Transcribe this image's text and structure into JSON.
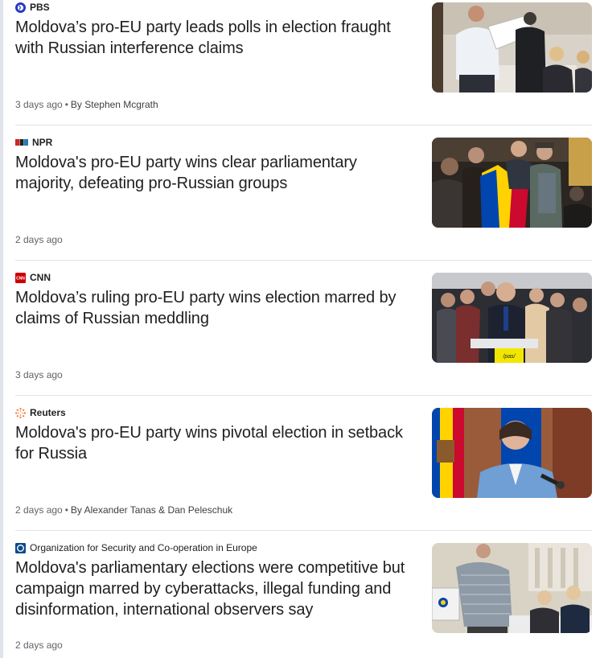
{
  "articles": [
    {
      "source": "PBS",
      "logo": "pbs-logo",
      "headline": "Moldova’s pro-EU party leads polls in election fraught with Russian interference claims",
      "time": "3 days ago",
      "byline": "By Stephen Mcgrath",
      "image": "vote-counting-photo"
    },
    {
      "source": "NPR",
      "logo": "npr-logo",
      "headline": "Moldova's pro-EU party wins clear parliamentary majority, defeating pro-Russian groups",
      "time": "2 days ago",
      "byline": "",
      "image": "supporters-with-flag-photo"
    },
    {
      "source": "CNN",
      "logo": "cnn-logo",
      "headline": "Moldova’s ruling pro-EU party wins election marred by claims of Russian meddling",
      "time": "3 days ago",
      "byline": "",
      "image": "speaker-at-podium-photo"
    },
    {
      "source": "Reuters",
      "logo": "reuters-logo",
      "headline": "Moldova's pro-EU party wins pivotal election in setback for Russia",
      "time": "2 days ago",
      "byline": "By Alexander Tanas & Dan Peleschuk",
      "image": "president-with-microphones-photo"
    },
    {
      "source": "Organization for Security and Co-operation in Europe",
      "logo": "osce-logo",
      "headline": "Moldova's parliamentary elections were competitive but campaign marred by cyberattacks, illegal funding and disinformation, international observers say",
      "time": "2 days ago",
      "byline": "",
      "image": "polling-station-photo"
    }
  ],
  "colors": {
    "cnn_red": "#cc0000",
    "pbs_blue": "#2638c4",
    "reuters_orange": "#f26b21",
    "osce_blue": "#0d4a8c",
    "moldova_blue": "#0046ae",
    "moldova_yellow": "#ffd200",
    "moldova_red": "#cc092f"
  }
}
